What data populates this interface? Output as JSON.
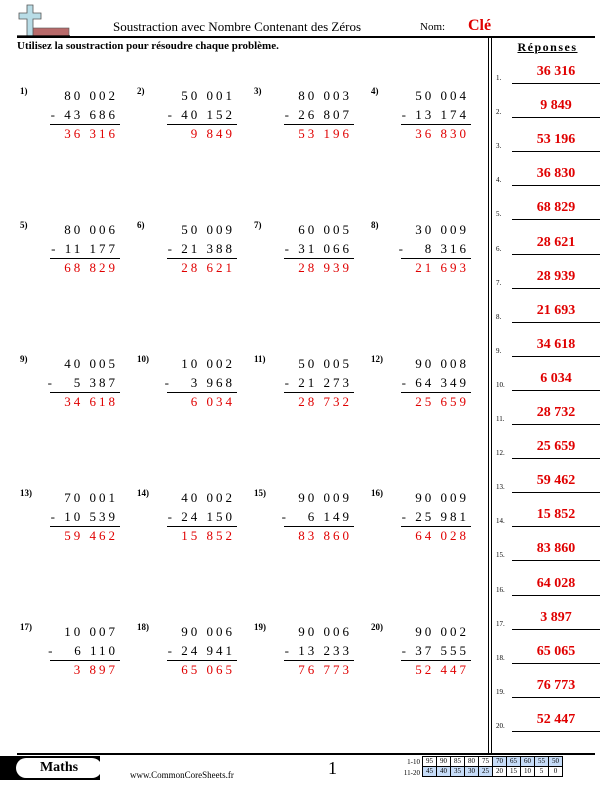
{
  "header": {
    "title": "Soustraction avec Nombre Contenant des Zéros",
    "nom_label": "Nom:",
    "nom_value": "Clé",
    "instructions": "Utilisez la soustraction pour résoudre chaque problème.",
    "answers_heading": "Réponses",
    "logo_icon": "plus-minus-logo-icon"
  },
  "problems": [
    {
      "num": "1)",
      "top": "80 002",
      "bottom": "- 43 686",
      "answer": "36 316"
    },
    {
      "num": "2)",
      "top": "50 001",
      "bottom": "- 40 152",
      "answer": "9 849"
    },
    {
      "num": "3)",
      "top": "80 003",
      "bottom": "- 26 807",
      "answer": "53 196"
    },
    {
      "num": "4)",
      "top": "50 004",
      "bottom": "- 13 174",
      "answer": "36 830"
    },
    {
      "num": "5)",
      "top": "80 006",
      "bottom": "- 11 177",
      "answer": "68 829"
    },
    {
      "num": "6)",
      "top": "50 009",
      "bottom": "- 21 388",
      "answer": "28 621"
    },
    {
      "num": "7)",
      "top": "60 005",
      "bottom": "- 31 066",
      "answer": "28 939"
    },
    {
      "num": "8)",
      "top": "30 009",
      "bottom": "-   8 316",
      "answer": "21 693"
    },
    {
      "num": "9)",
      "top": "40 005",
      "bottom": "-   5 387",
      "answer": "34 618"
    },
    {
      "num": "10)",
      "top": "10 002",
      "bottom": "-   3 968",
      "answer": "6 034"
    },
    {
      "num": "11)",
      "top": "50 005",
      "bottom": "- 21 273",
      "answer": "28 732"
    },
    {
      "num": "12)",
      "top": "90 008",
      "bottom": "- 64 349",
      "answer": "25 659"
    },
    {
      "num": "13)",
      "top": "70 001",
      "bottom": "- 10 539",
      "answer": "59 462"
    },
    {
      "num": "14)",
      "top": "40 002",
      "bottom": "- 24 150",
      "answer": "15 852"
    },
    {
      "num": "15)",
      "top": "90 009",
      "bottom": "-   6 149",
      "answer": "83 860"
    },
    {
      "num": "16)",
      "top": "90 009",
      "bottom": "- 25 981",
      "answer": "64 028"
    },
    {
      "num": "17)",
      "top": "10 007",
      "bottom": "-   6 110",
      "answer": "3 897"
    },
    {
      "num": "18)",
      "top": "90 006",
      "bottom": "- 24 941",
      "answer": "65 065"
    },
    {
      "num": "19)",
      "top": "90 006",
      "bottom": "- 13 233",
      "answer": "76 773"
    },
    {
      "num": "20)",
      "top": "90 002",
      "bottom": "- 37 555",
      "answer": "52 447"
    }
  ],
  "answers": [
    {
      "num": "1.",
      "value": "36 316"
    },
    {
      "num": "2.",
      "value": "9 849"
    },
    {
      "num": "3.",
      "value": "53 196"
    },
    {
      "num": "4.",
      "value": "36 830"
    },
    {
      "num": "5.",
      "value": "68 829"
    },
    {
      "num": "6.",
      "value": "28 621"
    },
    {
      "num": "7.",
      "value": "28 939"
    },
    {
      "num": "8.",
      "value": "21 693"
    },
    {
      "num": "9.",
      "value": "34 618"
    },
    {
      "num": "10.",
      "value": "6 034"
    },
    {
      "num": "11.",
      "value": "28 732"
    },
    {
      "num": "12.",
      "value": "25 659"
    },
    {
      "num": "13.",
      "value": "59 462"
    },
    {
      "num": "14.",
      "value": "15 852"
    },
    {
      "num": "15.",
      "value": "83 860"
    },
    {
      "num": "16.",
      "value": "64 028"
    },
    {
      "num": "17.",
      "value": "3 897"
    },
    {
      "num": "18.",
      "value": "65 065"
    },
    {
      "num": "19.",
      "value": "76 773"
    },
    {
      "num": "20.",
      "value": "52 447"
    }
  ],
  "footer": {
    "badge": "Maths",
    "site": "www.CommonCoreSheets.fr",
    "page": "1",
    "score_row_labels": [
      "1-10",
      "11-20"
    ],
    "score_rows": [
      [
        "95",
        "90",
        "85",
        "80",
        "75",
        "70",
        "65",
        "60",
        "55",
        "50"
      ],
      [
        "45",
        "40",
        "35",
        "30",
        "25",
        "20",
        "15",
        "10",
        "5",
        "0"
      ]
    ]
  }
}
